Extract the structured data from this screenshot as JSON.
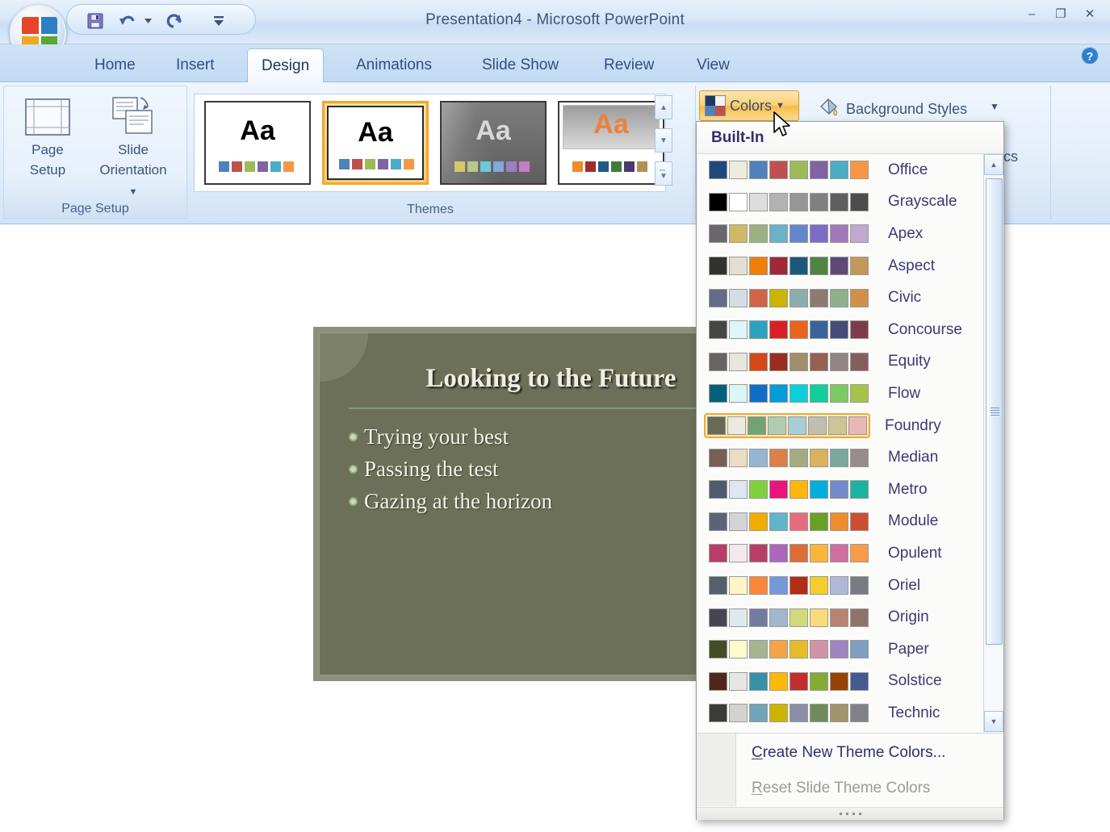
{
  "window": {
    "title": "Presentation4  -  Microsoft PowerPoint",
    "minimize_label": "–",
    "restore_label": "❐",
    "close_label": "✕"
  },
  "quick_access": {
    "items": [
      {
        "name": "save-icon",
        "label": "Save"
      },
      {
        "name": "undo-icon",
        "label": "Undo"
      },
      {
        "name": "undo-dropdown-icon",
        "label": "Undo options"
      },
      {
        "name": "redo-icon",
        "label": "Redo"
      },
      {
        "name": "customize-qat-icon",
        "label": "Customize Quick Access Toolbar"
      }
    ]
  },
  "office_button": {
    "name": "office-orb",
    "label": "Office Button"
  },
  "help_button": {
    "name": "help-icon",
    "label": "?"
  },
  "tabs": [
    {
      "label": "Home",
      "active": false
    },
    {
      "label": "Insert",
      "active": false
    },
    {
      "label": "Design",
      "active": true
    },
    {
      "label": "Animations",
      "active": false
    },
    {
      "label": "Slide Show",
      "active": false
    },
    {
      "label": "Review",
      "active": false
    },
    {
      "label": "View",
      "active": false
    }
  ],
  "ribbon": {
    "page_setup_group": {
      "label": "Page Setup",
      "buttons": [
        {
          "label_line1": "Page",
          "label_line2": "Setup",
          "icon": "page-setup-icon"
        },
        {
          "label_line1": "Slide",
          "label_line2": "Orientation",
          "icon": "slide-orientation-icon",
          "has_dropdown": true
        }
      ]
    },
    "themes_group": {
      "label": "Themes",
      "thumbnails": [
        {
          "name": "theme-office",
          "sample_text": "Aa",
          "selected": false,
          "bg": "#ffffff",
          "text_color": "#1a1a1a",
          "swatches": [
            "#4f81bd",
            "#c0504d",
            "#9bbb59",
            "#8064a2",
            "#4bacc6",
            "#f79646"
          ]
        },
        {
          "name": "theme-current",
          "sample_text": "Aa",
          "selected": true,
          "bg": "#ffffff",
          "text_color": "#1a1a1a",
          "swatches": [
            "#4f81bd",
            "#c0504d",
            "#9bbb59",
            "#8064a2",
            "#4bacc6",
            "#f79646"
          ]
        },
        {
          "name": "theme-dark",
          "sample_text": "Aa",
          "selected": false,
          "bg": "#6f6f6f",
          "text_color": "#d8d8d8",
          "swatches": [
            "#d6c86a",
            "#b5c98a",
            "#6ec7d8",
            "#7fa9d6",
            "#9a7fc4",
            "#c47fc4"
          ]
        },
        {
          "name": "theme-apex",
          "sample_text": "Aa",
          "selected": false,
          "bg": "#ffffff",
          "text_color": "#e8833a",
          "swatches": [
            "#f08a2a",
            "#a32b2b",
            "#1d5a84",
            "#3f7d3a",
            "#4b3a6b",
            "#b39055"
          ]
        }
      ],
      "scroll_up": "▲",
      "scroll_down": "▼",
      "more_label": "▼"
    },
    "background_group": {
      "colors_button": {
        "label": "Colors",
        "icon": "theme-colors-icon",
        "has_dropdown": true,
        "active": true
      },
      "background_styles": {
        "label": "Background Styles",
        "icon": "background-styles-icon",
        "has_dropdown": true
      },
      "hide_graphics": {
        "label": "phics"
      },
      "dialog_launcher": "⤡"
    }
  },
  "dropdown": {
    "header": "Built-In",
    "selected_theme": "Foundry",
    "themes": [
      {
        "name": "Office",
        "colors": [
          "#1f497d",
          "#eeece1",
          "#4f81bd",
          "#c0504d",
          "#9bbb59",
          "#8064a2",
          "#4bacc6",
          "#f79646"
        ]
      },
      {
        "name": "Grayscale",
        "colors": [
          "#000000",
          "#ffffff",
          "#dddddd",
          "#b2b2b2",
          "#969696",
          "#808080",
          "#5f5f5f",
          "#4d4d4d"
        ]
      },
      {
        "name": "Apex",
        "colors": [
          "#69676d",
          "#ceb966",
          "#9cb084",
          "#6bb1c9",
          "#6585cf",
          "#7e6bc9",
          "#a379bb",
          "#c0a8d0"
        ]
      },
      {
        "name": "Aspect",
        "colors": [
          "#323232",
          "#e3ded1",
          "#f07f09",
          "#9f2936",
          "#1b587c",
          "#4e8542",
          "#604878",
          "#c19859"
        ]
      },
      {
        "name": "Civic",
        "colors": [
          "#646b86",
          "#d5dce4",
          "#d16349",
          "#ccb400",
          "#8cadae",
          "#8c7b70",
          "#8fb08c",
          "#d19049"
        ]
      },
      {
        "name": "Concourse",
        "colors": [
          "#464646",
          "#def5fa",
          "#2da2bf",
          "#da1f28",
          "#eb641b",
          "#39639d",
          "#474b78",
          "#7d3c4a"
        ]
      },
      {
        "name": "Equity",
        "colors": [
          "#696464",
          "#e9e5dc",
          "#d34817",
          "#9b2d1f",
          "#a28e6a",
          "#956251",
          "#918485",
          "#855d5d"
        ]
      },
      {
        "name": "Flow",
        "colors": [
          "#04617b",
          "#dbf5f9",
          "#0f6fc6",
          "#009dd9",
          "#0bd0d9",
          "#10cf9b",
          "#7cca62",
          "#a5c249"
        ]
      },
      {
        "name": "Foundry",
        "colors": [
          "#676a55",
          "#eaebde",
          "#72a376",
          "#b0ccb0",
          "#a8cdd7",
          "#c0beaf",
          "#cec597",
          "#e8b7b7"
        ]
      },
      {
        "name": "Median",
        "colors": [
          "#775f55",
          "#ebddc3",
          "#94b6d2",
          "#dd8047",
          "#a5ab81",
          "#d8b25c",
          "#7ba79d",
          "#968c8c"
        ]
      },
      {
        "name": "Metro",
        "colors": [
          "#4e5b6f",
          "#dee6ef",
          "#7fd13b",
          "#ea157a",
          "#feb80a",
          "#00addc",
          "#738ac8",
          "#1ab39f"
        ]
      },
      {
        "name": "Module",
        "colors": [
          "#5a6378",
          "#d4d4d6",
          "#f0ad00",
          "#60b5cc",
          "#e66c7d",
          "#6b9f25",
          "#ee8d2c",
          "#cd4f32"
        ]
      },
      {
        "name": "Opulent",
        "colors": [
          "#b83d68",
          "#f4e7ed",
          "#b83d68",
          "#ac66bb",
          "#de6c36",
          "#f9b639",
          "#ce6fa0",
          "#f89a4b"
        ]
      },
      {
        "name": "Oriel",
        "colors": [
          "#575f6d",
          "#fef5c5",
          "#fe8637",
          "#7598d9",
          "#b32c16",
          "#f5cd2d",
          "#aebad5",
          "#777c84"
        ]
      },
      {
        "name": "Origin",
        "colors": [
          "#464653",
          "#dde9ea",
          "#727ca3",
          "#9fb8cd",
          "#d2da7a",
          "#fada7a",
          "#b88472",
          "#8e736a"
        ]
      },
      {
        "name": "Paper",
        "colors": [
          "#444d26",
          "#fefac9",
          "#a5b592",
          "#f3a447",
          "#e7bc29",
          "#d092a7",
          "#9c85c0",
          "#809ec2"
        ]
      },
      {
        "name": "Solstice",
        "colors": [
          "#4f271c",
          "#e7e6e6",
          "#3891a7",
          "#feb80a",
          "#c32d2e",
          "#84aa33",
          "#964305",
          "#475a8d"
        ]
      },
      {
        "name": "Technic",
        "colors": [
          "#3b3b3b",
          "#d4d2d0",
          "#6ea5b8",
          "#ccb400",
          "#8c8ea8",
          "#6f8b5c",
          "#a2946b",
          "#7f8289"
        ]
      }
    ],
    "footer": {
      "create_new_prefix": "C",
      "create_new_rest": "reate New Theme Colors...",
      "reset_prefix": "R",
      "reset_rest": "eset Slide Theme Colors",
      "reset_disabled": true
    },
    "scroll_up": "▲",
    "scroll_down": "▼"
  },
  "slide": {
    "title": "Looking to the Future",
    "bullets": [
      "Trying your best",
      "Passing the test",
      "Gazing at the horizon"
    ],
    "background_color": "#6d7059"
  }
}
